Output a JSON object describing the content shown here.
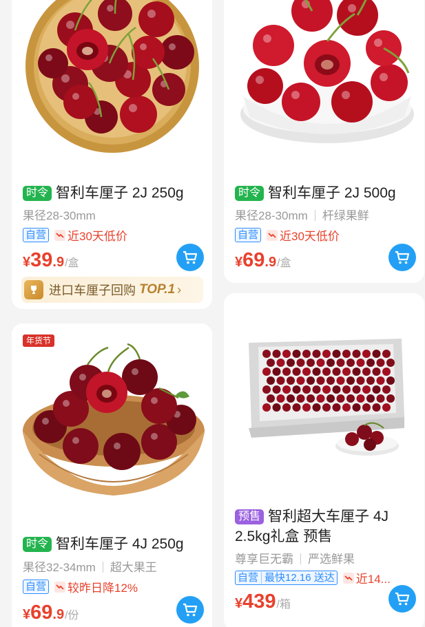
{
  "products": [
    {
      "tag": "时令",
      "title": "智利车厘子 2J 250g",
      "spec": "果径28-30mm",
      "spec_extra": "",
      "self_badge": "自营",
      "trend_text": "近30天低价",
      "price_currency": "¥",
      "price_int": "39",
      "price_dec": ".9",
      "price_unit": "/盒",
      "rank_text": "进口车厘子回购",
      "rank_top": "TOP.1",
      "rank_arrow": "›"
    },
    {
      "tag": "时令",
      "title": "智利车厘子 2J 500g",
      "spec": "果径28-30mm",
      "spec_extra": "杆绿果鲜",
      "self_badge": "自营",
      "trend_text": "近30天低价",
      "price_currency": "¥",
      "price_int": "69",
      "price_dec": ".9",
      "price_unit": "/盒"
    },
    {
      "festival": "年货节",
      "tag": "时令",
      "title": "智利车厘子 4J 250g",
      "spec": "果径32-34mm",
      "spec_extra": "超大果王",
      "self_badge": "自营",
      "trend_text": "较昨日降12%",
      "price_currency": "¥",
      "price_int": "69",
      "price_dec": ".9",
      "price_unit": "/份"
    },
    {
      "tag": "预售",
      "title": "智利超大车厘子 4J 2.5kg礼盒 预售",
      "spec": "尊享巨无霸",
      "spec_extra": "严选鲜果",
      "self_badge": "自营",
      "self_badge_extra": "最快12.16 送达",
      "trend_text": "近14...",
      "price_currency": "¥",
      "price_int": "439",
      "price_dec": "",
      "price_unit": "/箱"
    }
  ],
  "colors": {
    "price": "#e8412c",
    "tag_green": "#24b44f",
    "tag_purple": "#9b61e0",
    "cart": "#23a0f5",
    "self_badge": "#2c8dff"
  },
  "icons": {
    "cart": "shopping-cart-icon",
    "trend": "price-down-trend-icon",
    "rank": "trophy-icon"
  }
}
